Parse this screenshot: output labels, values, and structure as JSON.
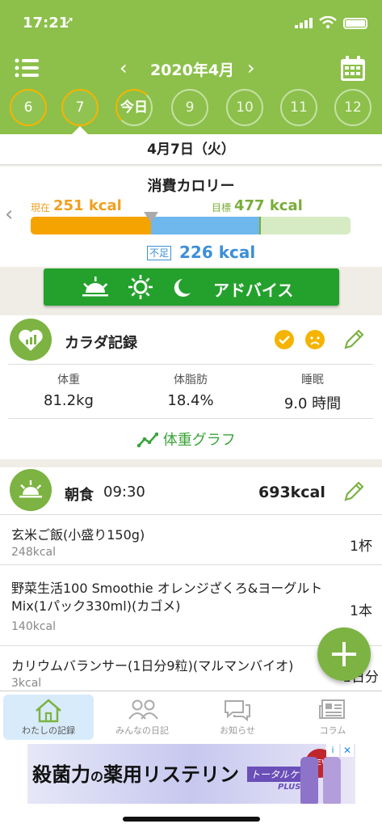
{
  "status": {
    "time": "17:21"
  },
  "nav": {
    "month": "2020年4月",
    "prev": "<",
    "next": ">"
  },
  "days": [
    {
      "label": "6",
      "state": "logged"
    },
    {
      "label": "7",
      "state": "selected"
    },
    {
      "label": "今日",
      "state": "today"
    },
    {
      "label": "9",
      "state": "future"
    },
    {
      "label": "10",
      "state": "future"
    },
    {
      "label": "11",
      "state": "future"
    },
    {
      "label": "12",
      "state": "future"
    }
  ],
  "date_strip": "4月7日（火）",
  "calories": {
    "title": "消費カロリー",
    "current_label": "現在",
    "current_value": "251 kcal",
    "goal_label": "目標",
    "goal_value": "477 kcal",
    "deficit_label": "不足",
    "deficit_value": "226 kcal",
    "current_kcal": 251,
    "goal_kcal": 477
  },
  "advice": {
    "label": "アドバイス"
  },
  "body_record": {
    "title": "カラダ記録",
    "stats": [
      {
        "label": "体重",
        "value": "81.2kg"
      },
      {
        "label": "体脂肪",
        "value": "18.4%"
      },
      {
        "label": "睡眠",
        "value": "9.0 時間"
      }
    ],
    "graph_link": "体重グラフ"
  },
  "breakfast": {
    "title": "朝食",
    "time": "09:30",
    "kcal": "693kcal",
    "items": [
      {
        "name": "玄米ご飯(小盛り150g)",
        "kcal": "248kcal",
        "qty": "1杯"
      },
      {
        "name": "野菜生活100 Smoothie オレンジざくろ&ヨーグルトMix(1パック330ml)(カゴメ)",
        "kcal": "140kcal",
        "qty": "1本"
      },
      {
        "name": "カリウムバランサー(1日分9粒)(マルマンバイオ)",
        "kcal": "3kcal",
        "qty": "1日分"
      }
    ]
  },
  "tabs": [
    {
      "label": "わたしの記録",
      "icon": "home-icon",
      "active": true
    },
    {
      "label": "みんなの日記",
      "icon": "people-icon",
      "active": false
    },
    {
      "label": "お知らせ",
      "icon": "chat-icon",
      "active": false
    },
    {
      "label": "コラム",
      "icon": "newspaper-icon",
      "active": false
    }
  ],
  "ad": {
    "headline_1": "殺菌力",
    "headline_2": "の",
    "headline_3": "薬用リステリン",
    "product": "トータルケア",
    "product_sub": "PLUS",
    "badge": "NEW"
  },
  "colors": {
    "header_green": "#8cc04a",
    "accent_green": "#7cb342",
    "advice_green": "#24a12c",
    "orange": "#f5a300",
    "blue": "#3d8fd6"
  }
}
